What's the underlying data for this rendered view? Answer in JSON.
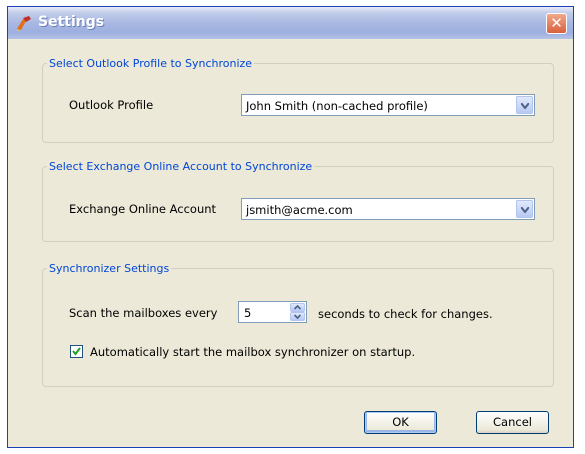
{
  "window": {
    "title": "Settings"
  },
  "outlook_group": {
    "legend": "Select Outlook Profile to Synchronize",
    "profile_label": "Outlook Profile",
    "profile_value": "John Smith (non-cached profile)"
  },
  "exchange_group": {
    "legend": "Select Exchange Online Account to Synchronize",
    "account_label": "Exchange Online Account",
    "account_value": "jsmith@acme.com"
  },
  "sync_group": {
    "legend": "Synchronizer Settings",
    "scan_label": "Scan the mailboxes every",
    "scan_value": "5",
    "scan_suffix": "seconds to check for changes.",
    "autostart_label": "Automatically start the mailbox synchronizer on startup.",
    "autostart_checked": true
  },
  "buttons": {
    "ok": "OK",
    "cancel": "Cancel"
  },
  "icons": {
    "app": "settings-app-icon",
    "close": "close-icon",
    "dropdown": "chevron-down-icon",
    "spin_up": "spin-up-icon",
    "spin_down": "spin-down-icon",
    "check": "checkmark-icon"
  },
  "colors": {
    "dialog_bg": "#ece9d8",
    "legend_text": "#0046d5",
    "close_button": "#d8603c"
  }
}
